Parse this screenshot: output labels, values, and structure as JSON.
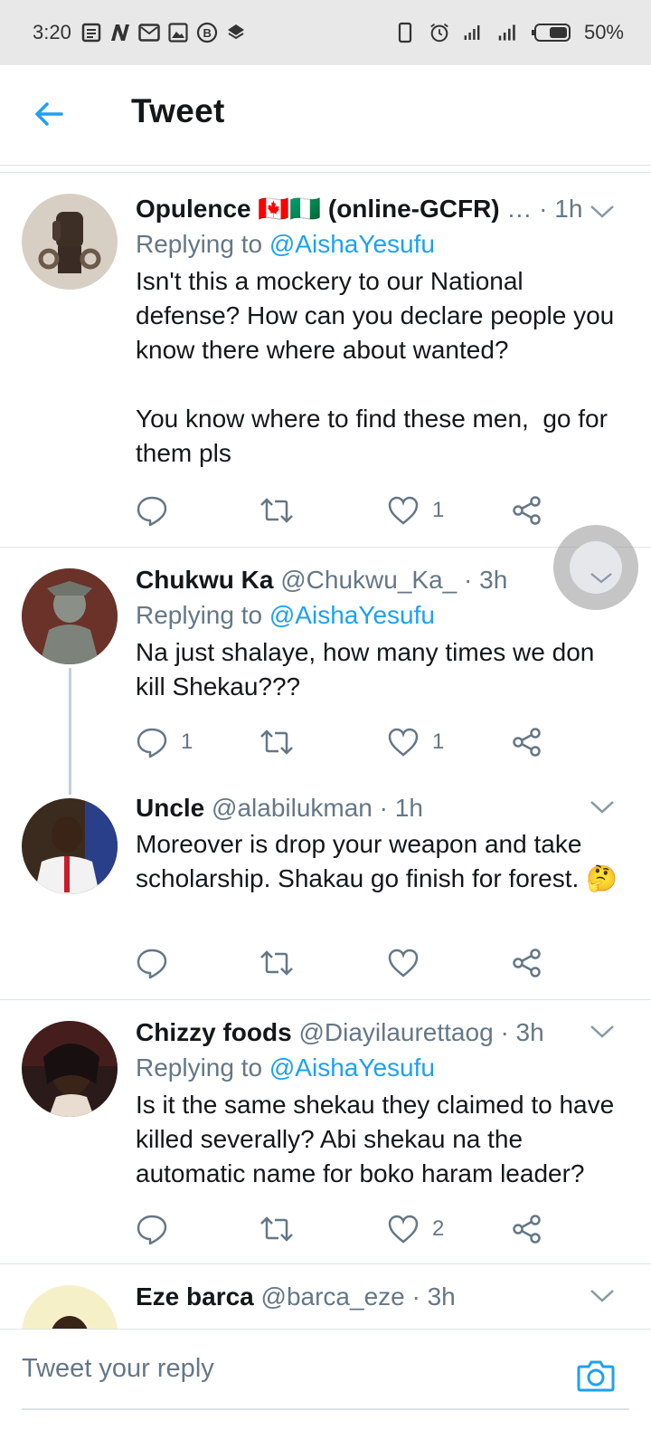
{
  "status_bar": {
    "time": "3:20",
    "battery": "50%"
  },
  "header": {
    "title": "Tweet"
  },
  "tweets": [
    {
      "name": "Opulence 🇨🇦🇳🇬 (online-GCFR)",
      "handle": "…",
      "time": "1h",
      "replying_label": "Replying to",
      "replying_to": "@AishaYesufu",
      "text": "Isn't this a mockery to our National defense? How can you declare people you  know there where about wanted?\n\nYou know where to find these men,  go for them pls",
      "replies": "",
      "likes": "1",
      "avatar": "fist-avatar"
    },
    {
      "name": "Chukwu Ka",
      "handle": "@Chukwu_Ka_",
      "time": "3h",
      "replying_label": "Replying to",
      "replying_to": "@AishaYesufu",
      "text": "Na just shalaye, how many times we don kill Shekau???",
      "replies": "1",
      "likes": "1",
      "avatar": "statue-avatar"
    },
    {
      "name": "Uncle",
      "handle": "@alabilukman",
      "time": "1h",
      "text": "Moreover is drop your weapon and take scholarship. Shakau go finish for forest. 🤔",
      "replies": "",
      "likes": "",
      "avatar": "man-avatar"
    },
    {
      "name": "Chizzy foods",
      "handle": "@Diayilaurettaog",
      "time": "3h",
      "replying_label": "Replying to",
      "replying_to": "@AishaYesufu",
      "text": "Is it the same shekau they claimed to have killed severally? Abi shekau na the automatic name for boko haram leader?",
      "replies": "",
      "likes": "2",
      "avatar": "woman-avatar"
    },
    {
      "name": "Eze barca",
      "handle": "@barca_eze",
      "time": "3h",
      "avatar": "boy-avatar"
    }
  ],
  "reply_bar": {
    "placeholder": "Tweet your reply"
  },
  "colors": {
    "accent": "#1da1f2",
    "secondary_text": "#657786",
    "divider": "#dfe3e6"
  }
}
